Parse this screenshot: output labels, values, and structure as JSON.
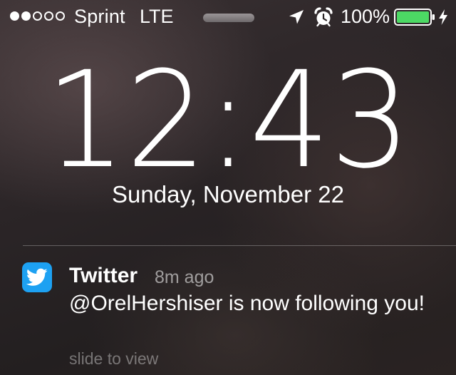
{
  "status_bar": {
    "signal_bars_filled": 2,
    "signal_bars_total": 5,
    "carrier": "Sprint",
    "network": "LTE",
    "battery_percent": "100%",
    "battery_level": 1.0,
    "battery_color": "#4cd964",
    "icons": [
      "location-arrow-icon",
      "alarm-clock-icon",
      "battery-icon",
      "charging-bolt-icon"
    ]
  },
  "lock_screen": {
    "time": "12:43",
    "date": "Sunday, November 22"
  },
  "notification": {
    "app_icon": "twitter-bird-icon",
    "app_color": "#1da1f2",
    "app_name": "Twitter",
    "time_ago": "8m ago",
    "message": "@OrelHershiser is now following you!",
    "hint": "slide to view"
  }
}
